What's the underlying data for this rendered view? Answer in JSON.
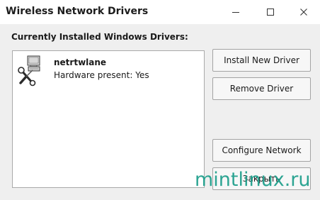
{
  "window": {
    "title": "Wireless Network Drivers",
    "controls": {
      "minimize": "minimize-icon",
      "maximize": "maximize-icon",
      "close": "close-icon"
    }
  },
  "section_label": "Currently Installed Windows Drivers:",
  "drivers": [
    {
      "name": "netrtwlane",
      "status": "Hardware present: Yes",
      "icon": "driver-tools-computer-icon"
    }
  ],
  "buttons": {
    "install": "Install New Driver",
    "remove": "Remove Driver",
    "configure": "Configure Network",
    "close": "Закрыть"
  },
  "watermark": "mintlinux.ru",
  "colors": {
    "watermark": "#1b9e8a",
    "background": "#efefef",
    "list_background": "#ffffff"
  }
}
